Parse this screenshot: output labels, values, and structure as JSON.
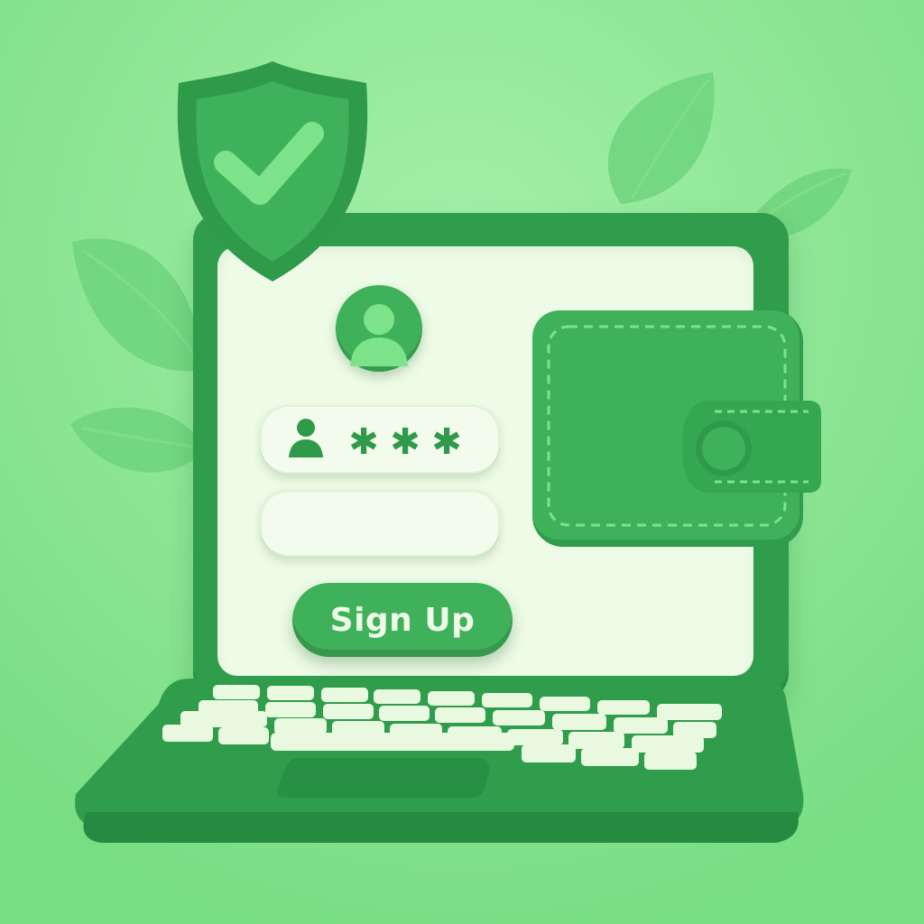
{
  "colors": {
    "background": "#86e58f",
    "background_light": "#a4f0a8",
    "leaf": "#6fd47d",
    "dark_green": "#2e9a4a",
    "mid_green": "#3fb15a",
    "bright_green": "#58d36c",
    "screen_cream": "#eefbe6",
    "field_fill": "#f3fcec",
    "key_fill": "#e9f9df",
    "deck_green": "#2f9d4b"
  },
  "login_form": {
    "avatar_icon": "user-circle-icon",
    "username_icon": "person-icon",
    "password_mask": [
      "✱",
      "✱",
      "✱"
    ],
    "second_field_value": "",
    "signup_label": "Sign Up"
  },
  "decor": {
    "shield_icon": "shield-check-icon",
    "wallet_icon": "wallet-icon",
    "leaf_icon": "leaf-icon"
  }
}
